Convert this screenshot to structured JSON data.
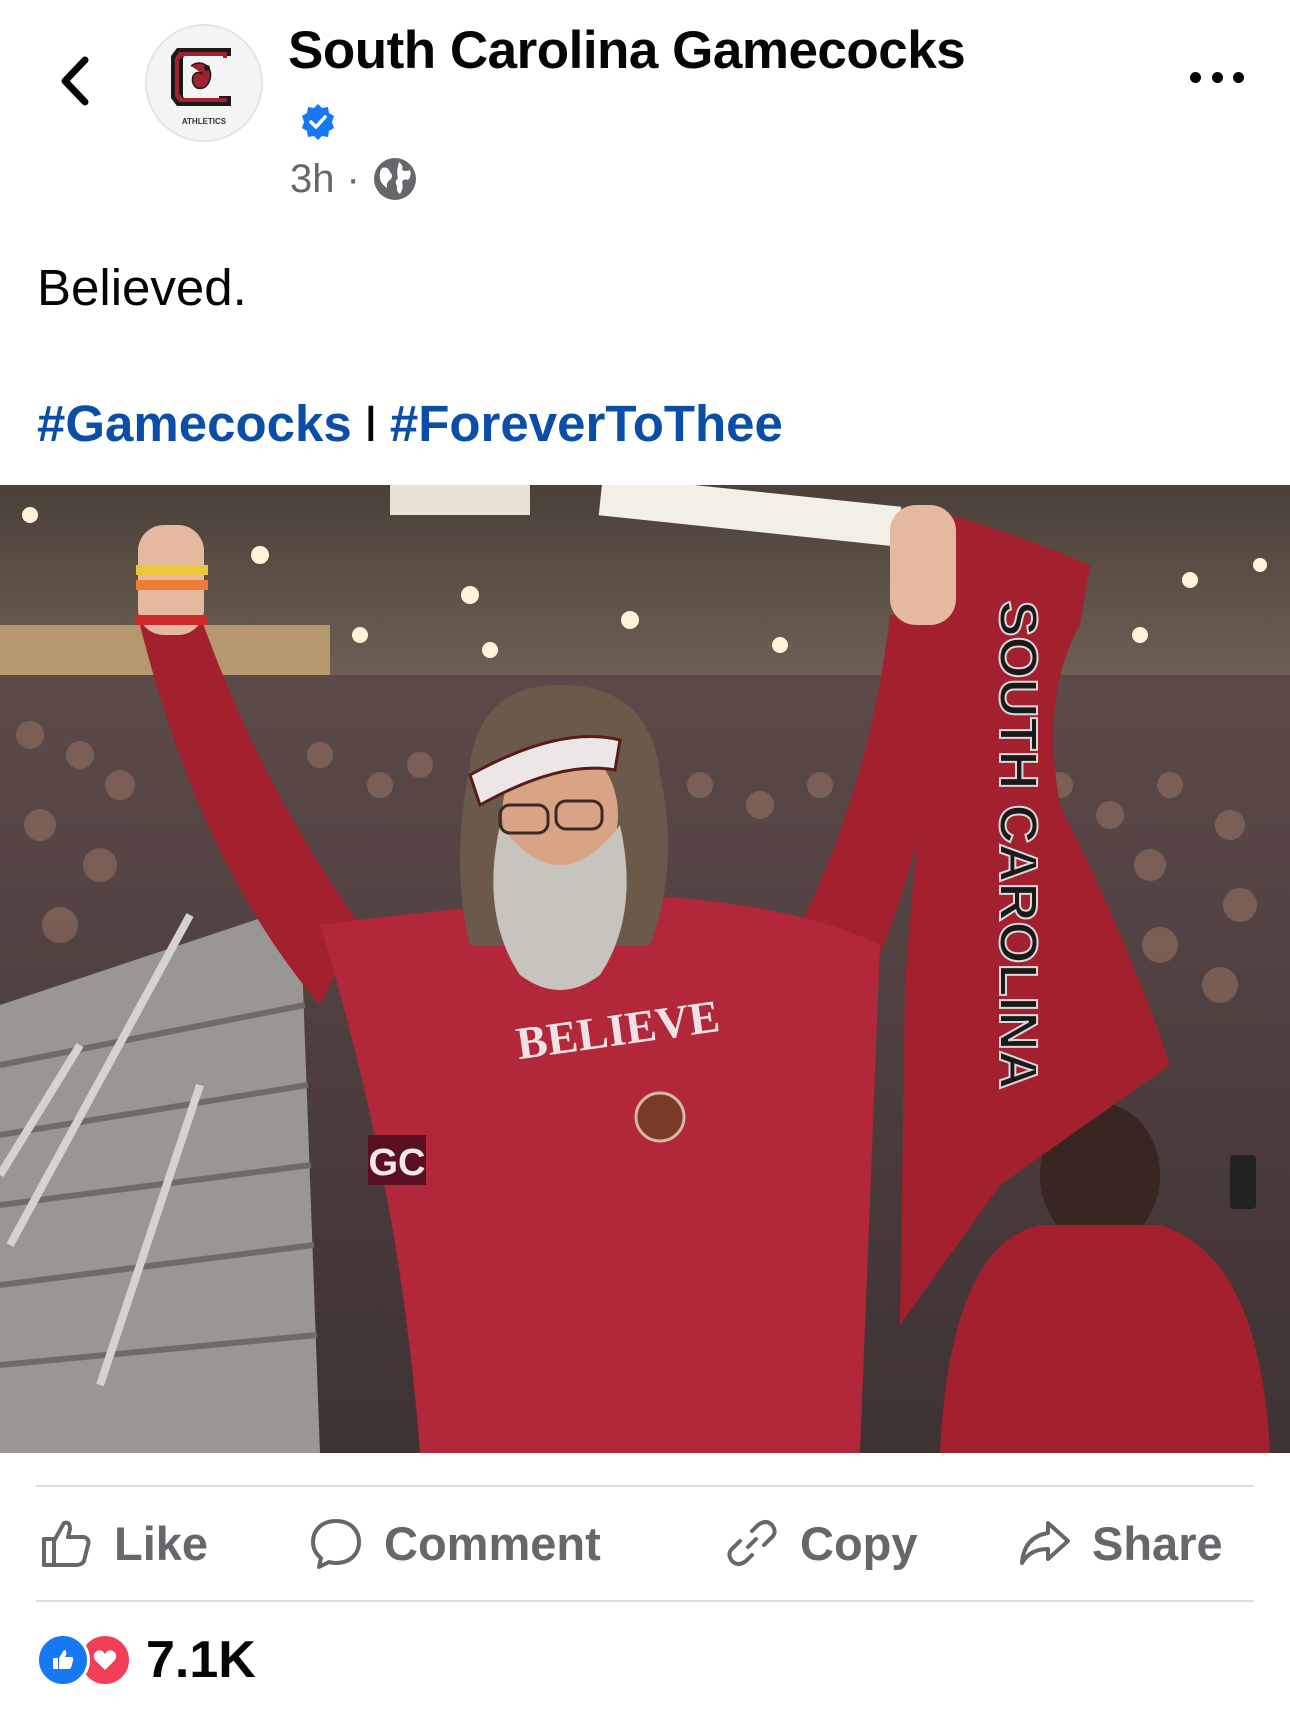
{
  "post": {
    "author": {
      "name": "South Carolina Gamecocks",
      "avatar_text": "ATHLETICS",
      "verified": true
    },
    "time": "3h",
    "separator": "·",
    "visibility_icon": "globe-icon",
    "caption": "Believed.",
    "hashtags": [
      "#Gamecocks",
      "#ForeverToThee"
    ],
    "hashtag_separator": "I",
    "photo": {
      "shirt_text": "BELIEVE",
      "towel_text": "SOUTH CAROLINA",
      "watermark": "GC"
    }
  },
  "actions": {
    "like_label": "Like",
    "comment_label": "Comment",
    "copy_label": "Copy",
    "share_label": "Share"
  },
  "reactions": {
    "count": "7.1K",
    "types": [
      "like",
      "love"
    ]
  },
  "colors": {
    "garnet": "#a3202f",
    "link_blue": "#0a4ea8",
    "verified_blue": "#1877f2",
    "muted": "#65676b"
  }
}
